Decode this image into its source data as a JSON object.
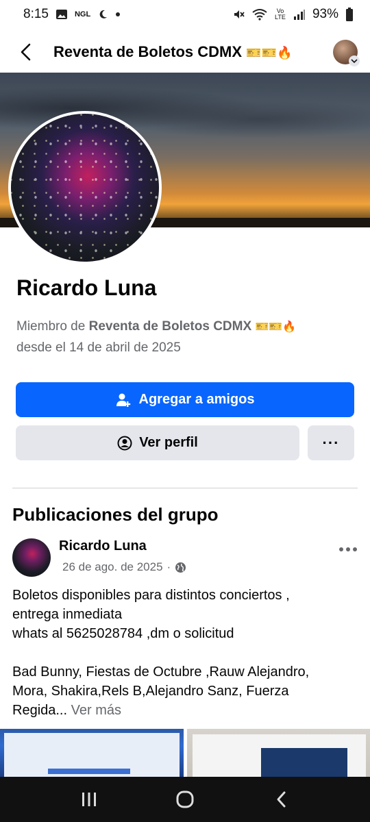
{
  "status_bar": {
    "time": "8:15",
    "left_badge": "NGL",
    "battery": "93%",
    "volte": "Vo LTE"
  },
  "header": {
    "title": "Reventa de Boletos CDMX",
    "title_emoji": "🎫🎫🔥"
  },
  "profile": {
    "name": "Ricardo Luna",
    "member_prefix": "Miembro de ",
    "group_name": "Reventa de Boletos CDMX",
    "group_emoji": "🎫🎫🔥",
    "member_since": "desde el 14 de abril de 2025"
  },
  "actions": {
    "add_friend_label": "Agregar a amigos",
    "view_profile_label": "Ver perfil",
    "more_label": "···"
  },
  "posts_section": {
    "title": "Publicaciones del grupo",
    "post": {
      "author": "Ricardo Luna",
      "date": "26 de ago. de 2025",
      "separator": "·",
      "line1": "Boletos disponibles para distintos conciertos ,",
      "line2": "entrega inmediata",
      "line3": "whats al 5625028784 ,dm o solicitud",
      "line4": "Bad Bunny, Fiestas de Octubre ,Rauw Alejandro,",
      "line5": "Mora, Shakira,Rels B,Alejandro Sanz, Fuerza",
      "line6": "Regida...",
      "see_more": " Ver más"
    }
  },
  "icons": {
    "back": "back-arrow-icon",
    "globe": "globe-icon",
    "add_friend": "add-friend-icon",
    "profile": "user-circle-icon"
  }
}
